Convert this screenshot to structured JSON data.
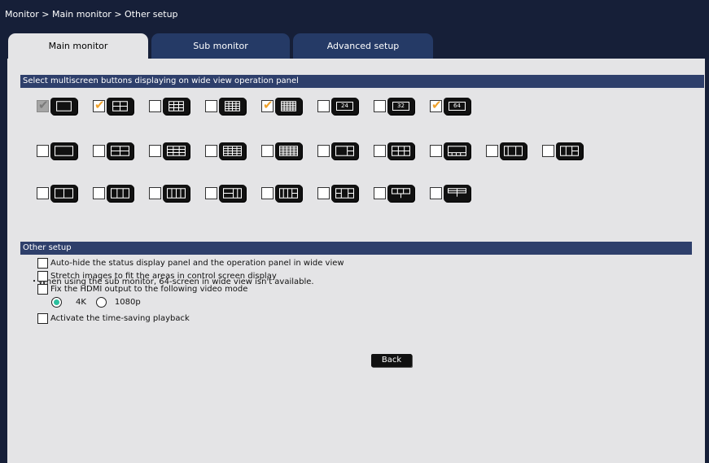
{
  "breadcrumb": "Monitor > Main monitor > Other setup",
  "tabs": [
    "Main monitor",
    "Sub monitor",
    "Advanced setup"
  ],
  "section1_title": "Select multiscreen buttons displaying on wide view operation panel",
  "multiscreen_rows": [
    [
      {
        "layout": "1",
        "checked": true,
        "disabled": true
      },
      {
        "layout": "4",
        "checked": true
      },
      {
        "layout": "9",
        "checked": false
      },
      {
        "layout": "16",
        "checked": false
      },
      {
        "layout": "25",
        "checked": true
      },
      {
        "layout": "24",
        "checked": false
      },
      {
        "layout": "32",
        "checked": false
      },
      {
        "layout": "64",
        "checked": true
      }
    ],
    [
      {
        "layout": "1-wide",
        "checked": false
      },
      {
        "layout": "4-wide",
        "checked": false
      },
      {
        "layout": "9-wide",
        "checked": false
      },
      {
        "layout": "16-wide",
        "checked": false
      },
      {
        "layout": "25-wide",
        "checked": false
      },
      {
        "layout": "1+2",
        "checked": false
      },
      {
        "layout": "1+3",
        "checked": false
      },
      {
        "layout": "1+5",
        "checked": false
      },
      {
        "layout": "1+1",
        "checked": false
      },
      {
        "layout": "1+1b",
        "checked": false
      }
    ],
    [
      {
        "layout": "2",
        "checked": false
      },
      {
        "layout": "3",
        "checked": false
      },
      {
        "layout": "4-col",
        "checked": false
      },
      {
        "layout": "1+2v",
        "checked": false
      },
      {
        "layout": "1+3v",
        "checked": false
      },
      {
        "layout": "2+2",
        "checked": false
      },
      {
        "layout": "t-layout",
        "checked": false
      },
      {
        "layout": "t-layout-2",
        "checked": false
      }
    ]
  ],
  "note": "・When using the sub monitor, 64-screen in wide view isn't available.",
  "section2_title": "Other setup",
  "options": {
    "auto_hide": "Auto-hide the status display panel and the operation panel in wide view",
    "stretch": "Stretch images to fit the areas in control screen display",
    "fix_hdmi": "Fix the HDMI output to the following video mode",
    "time_saving": "Activate the time-saving playback"
  },
  "video_mode": {
    "options": [
      "4K",
      "1080p"
    ],
    "selected": "4K"
  },
  "back_label": "Back",
  "colors": {
    "background": "#161f38",
    "panel": "#e4e4e6",
    "section_bar": "#2e3f6b",
    "tab_inactive": "#253a66",
    "check": "#f0a22c",
    "radio_selected": "#2bbf9e"
  }
}
